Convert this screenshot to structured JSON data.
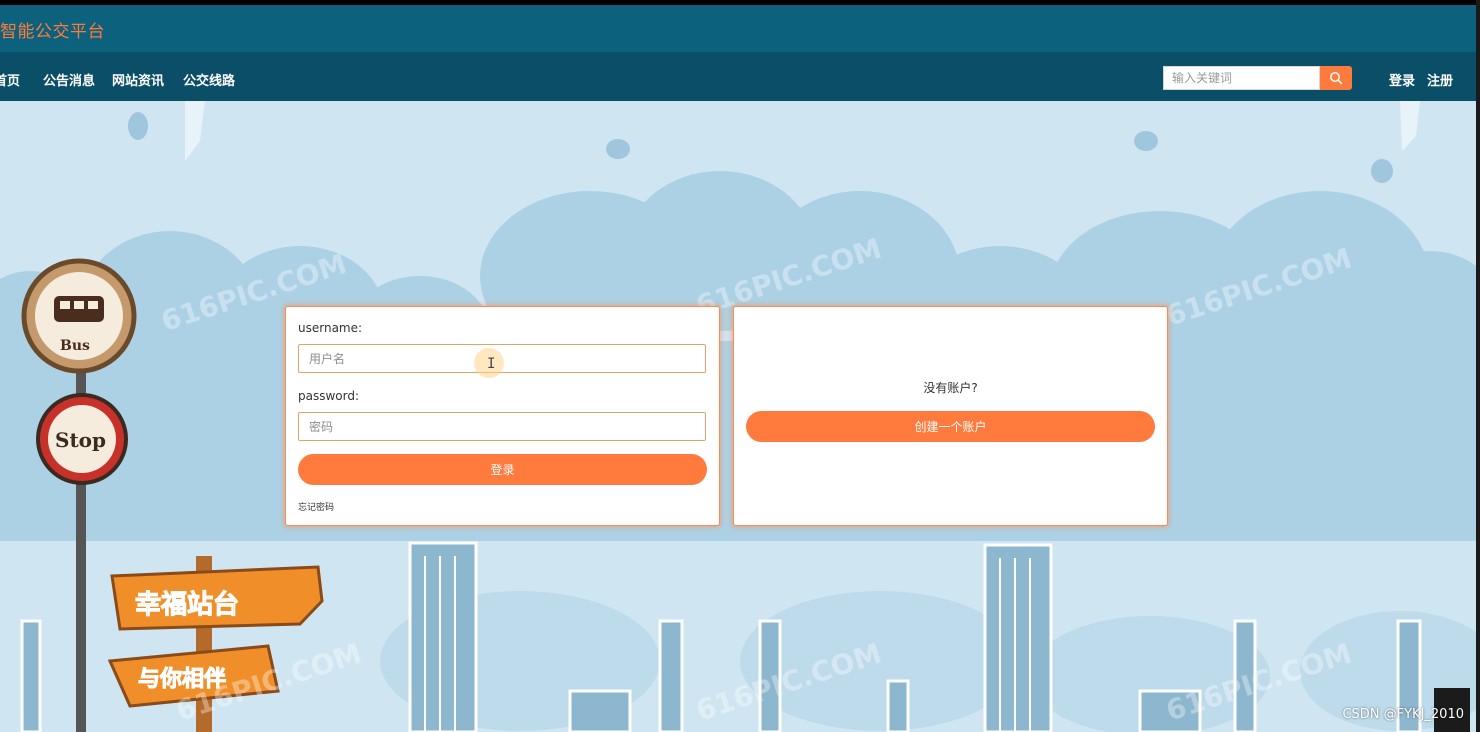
{
  "header": {
    "title": "智能公交平台"
  },
  "nav": {
    "items": [
      "首页",
      "公告消息",
      "网站资讯",
      "公交线路"
    ],
    "search": {
      "placeholder": "输入关键词",
      "value": ""
    },
    "login_label": "登录",
    "register_label": "注册"
  },
  "login_form": {
    "username_label": "username:",
    "username_placeholder": "用户名",
    "password_label": "password:",
    "password_placeholder": "密码",
    "submit_label": "登录",
    "forgot_label": "忘记密码"
  },
  "register_panel": {
    "prompt": "没有账户?",
    "create_label": "创建一个账户"
  },
  "background_art": {
    "bus_sign": "Bus",
    "stop_sign": "Stop",
    "board_top": "幸福站台",
    "board_bottom": "与你相伴",
    "site_watermark": "616PIC.COM"
  },
  "watermark": "CSDN @FYKJ_2010",
  "colors": {
    "brand_bar": "#0c617d",
    "nav_bar": "#0a4e68",
    "accent": "#ff7a3d",
    "sky": "#cfe6f2"
  }
}
